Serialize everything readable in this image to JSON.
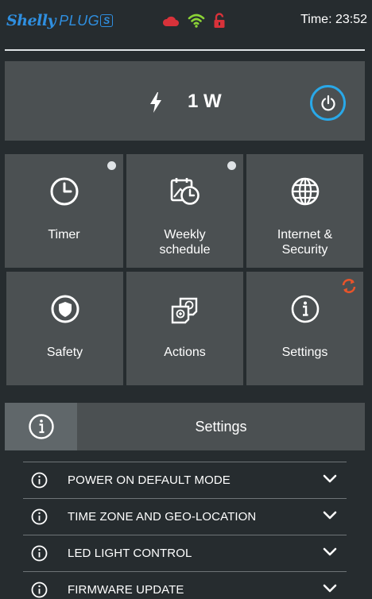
{
  "header": {
    "brand": "Shelly",
    "product": "PLUG",
    "product_badge": "S",
    "brand_color": "#2f8fe0",
    "status_icons": [
      "cloud-icon",
      "wifi-icon",
      "unlocked-padlock-icon"
    ],
    "time_label": "Time: 23:52"
  },
  "power": {
    "value": "1 W",
    "icon": "lightning-bolt-icon",
    "toggle_icon": "power-icon",
    "accent": "#29a8e8"
  },
  "tiles": [
    {
      "label": "Timer",
      "icon": "clock-icon",
      "indicator": true
    },
    {
      "label": "Weekly\nschedule",
      "icon": "schedule-icon",
      "indicator": true
    },
    {
      "label": "Internet &\nSecurity",
      "icon": "globe-icon",
      "indicator": false
    },
    {
      "label": "Safety",
      "icon": "shield-icon",
      "indicator": false
    },
    {
      "label": "Actions",
      "icon": "actions-icon",
      "indicator": false
    },
    {
      "label": "Settings",
      "icon": "info-icon",
      "indicator": false,
      "badge": "refresh-icon",
      "badge_color": "#e8542a"
    }
  ],
  "settings_panel": {
    "title": "Settings",
    "icon": "info-icon",
    "items": [
      {
        "label": "POWER ON DEFAULT MODE"
      },
      {
        "label": "TIME ZONE AND GEO-LOCATION"
      },
      {
        "label": "LED LIGHT CONTROL"
      },
      {
        "label": "FIRMWARE UPDATE"
      }
    ]
  }
}
